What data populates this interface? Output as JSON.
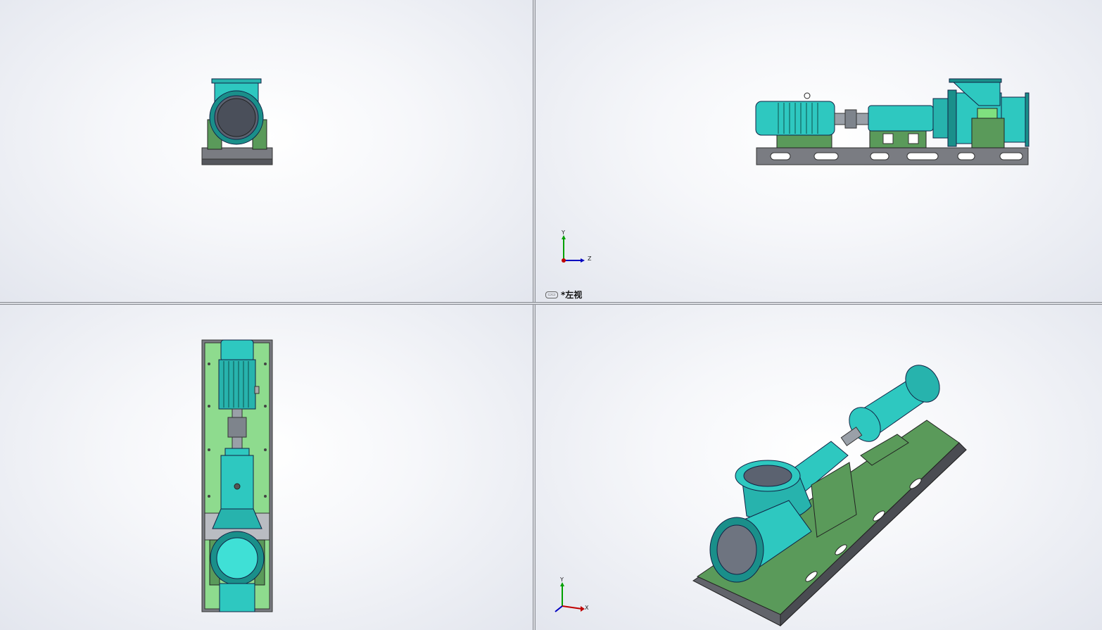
{
  "viewports": {
    "top_left": {
      "name": "front-view"
    },
    "top_right": {
      "name": "left-view",
      "label": "*左视",
      "triad": {
        "y": "Y",
        "z": "Z"
      }
    },
    "bottom_left": {
      "name": "top-view"
    },
    "bottom_right": {
      "name": "isometric-view",
      "triad": {
        "y": "Y",
        "x": "X"
      }
    }
  },
  "colors": {
    "pump_body": "#2ec8c0",
    "pump_dark": "#1a8f8a",
    "base_frame": "#6e7077",
    "support": "#5a9a5a",
    "plate": "#8edb8e",
    "triad_x": "#c00000",
    "triad_y": "#00a000",
    "triad_z": "#0000c0"
  },
  "icons": {
    "view_icon": "view-orientation-icon"
  }
}
